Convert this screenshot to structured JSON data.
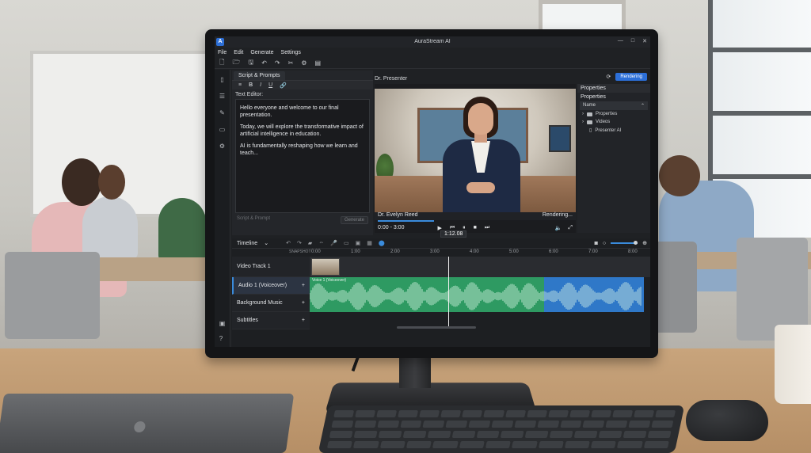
{
  "window": {
    "title": "AuraStream AI",
    "logo": "A",
    "controls": [
      "—",
      "□",
      "✕"
    ]
  },
  "menu": [
    "File",
    "Edit",
    "Generate",
    "Settings"
  ],
  "toolbar_icons": [
    "new-file-icon",
    "open-folder-icon",
    "save-icon",
    "undo-icon",
    "redo-icon",
    "cut-icon",
    "settings-icon",
    "export-icon"
  ],
  "script_panel": {
    "tab": "Script & Prompts",
    "format_buttons": [
      "≡",
      "B",
      "I",
      "U",
      "🔗"
    ],
    "editor_label": "Text Editor:",
    "paragraphs": [
      "Hello everyone and welcome to our final presentation.",
      "Today, we will explore the transformative impact of artificial intelligence in education.",
      "AI is fundamentally reshaping how we learn and teach..."
    ],
    "footer_placeholder": "Script & Prompt",
    "generate_label": "Generate"
  },
  "preview": {
    "label": "Dr. Presenter",
    "presenter_name": "Dr. Evelyn Reed",
    "status": "Rendering...",
    "time": "0:00 - 3:00",
    "progress": 0.28
  },
  "render_button": "Rendering",
  "properties": {
    "header": "Properties",
    "subheader": "Properties",
    "name_label": "Name",
    "items": [
      "Properties",
      "Videos",
      "Presenter AI"
    ]
  },
  "timeline": {
    "label": "Timeline",
    "playhead_time": "1:12.08",
    "ruler_marks": [
      "0:00",
      "1:00",
      "2:00",
      "3:00",
      "4:00",
      "5:00",
      "6:00",
      "7:00",
      "8:00"
    ],
    "tracks": [
      {
        "label": "Video Track 1"
      },
      {
        "label": "Audio 1 (Voiceover)"
      },
      {
        "label": "Background Music"
      },
      {
        "label": "Subtitles"
      }
    ],
    "clip_label": "Voice 1 (Voiceover)",
    "track_header_tag": "SNAPSHOT"
  }
}
